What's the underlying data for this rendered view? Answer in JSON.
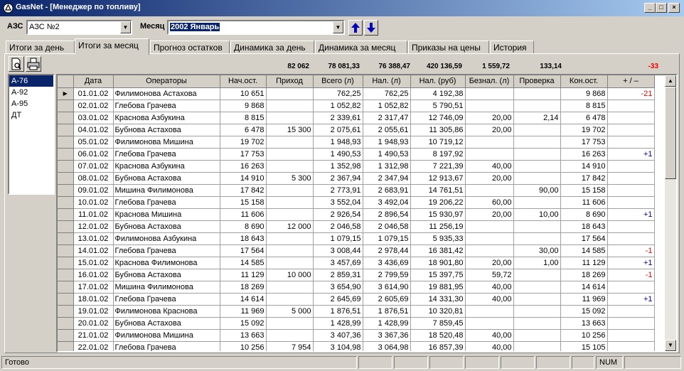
{
  "window": {
    "title": "GasNet - [Менеджер по топливу]",
    "icon": "gasnet-app-icon",
    "controls": [
      "_",
      "□",
      "×"
    ]
  },
  "filters": {
    "station_label": "АЗС",
    "station_value": "АЗС №2",
    "month_label": "Месяц",
    "month_value": "2002 Январь"
  },
  "tabs": [
    {
      "label": "Итоги за день"
    },
    {
      "label": "Итоги за месяц",
      "active": true
    },
    {
      "label": "Прогноз остатков"
    },
    {
      "label": "Динамика за день"
    },
    {
      "label": "Динамика за месяц"
    },
    {
      "label": "Приказы на цены"
    },
    {
      "label": "История"
    }
  ],
  "toolbar": [
    "preview-icon",
    "print-icon"
  ],
  "totals": {
    "incoming": "82 062",
    "total": "78 081,33",
    "cash_l": "76 388,47",
    "cash_rub": "420 136,59",
    "noncash": "1 559,72",
    "check": "133,14",
    "diff": "-33"
  },
  "fuel_types": [
    "А-76",
    "А-92",
    "А-95",
    "ДТ"
  ],
  "selected_fuel": 0,
  "columns": [
    "Дата",
    "Операторы",
    "Нач.ост.",
    "Приход",
    "Всего (л)",
    "Нал. (л)",
    "Нал. (руб)",
    "Безнал. (л)",
    "Проверка",
    "Кон.ост.",
    "+ / –"
  ],
  "rows": [
    [
      "01.01.02",
      "Филимонова Астахова",
      "10 651",
      "",
      "762,25",
      "762,25",
      "4 192,38",
      "",
      "",
      "9 868",
      "-21"
    ],
    [
      "02.01.02",
      "Глебова Грачева",
      "9 868",
      "",
      "1 052,82",
      "1 052,82",
      "5 790,51",
      "",
      "",
      "8 815",
      ""
    ],
    [
      "03.01.02",
      "Краснова Азбукина",
      "8 815",
      "",
      "2 339,61",
      "2 317,47",
      "12 746,09",
      "20,00",
      "2,14",
      "6 478",
      ""
    ],
    [
      "04.01.02",
      "Бубнова Астахова",
      "6 478",
      "15 300",
      "2 075,61",
      "2 055,61",
      "11 305,86",
      "20,00",
      "",
      "19 702",
      ""
    ],
    [
      "05.01.02",
      "Филимонова Мишина",
      "19 702",
      "",
      "1 948,93",
      "1 948,93",
      "10 719,12",
      "",
      "",
      "17 753",
      ""
    ],
    [
      "06.01.02",
      "Глебова Грачева",
      "17 753",
      "",
      "1 490,53",
      "1 490,53",
      "8 197,92",
      "",
      "",
      "16 263",
      "+1"
    ],
    [
      "07.01.02",
      "Краснова Азбукина",
      "16 263",
      "",
      "1 352,98",
      "1 312,98",
      "7 221,39",
      "40,00",
      "",
      "14 910",
      ""
    ],
    [
      "08.01.02",
      "Бубнова Астахова",
      "14 910",
      "5 300",
      "2 367,94",
      "2 347,94",
      "12 913,67",
      "20,00",
      "",
      "17 842",
      ""
    ],
    [
      "09.01.02",
      "Мишина Филимонова",
      "17 842",
      "",
      "2 773,91",
      "2 683,91",
      "14 761,51",
      "",
      "90,00",
      "15 158",
      ""
    ],
    [
      "10.01.02",
      "Глебова Грачева",
      "15 158",
      "",
      "3 552,04",
      "3 492,04",
      "19 206,22",
      "60,00",
      "",
      "11 606",
      ""
    ],
    [
      "11.01.02",
      "Краснова Мишина",
      "11 606",
      "",
      "2 926,54",
      "2 896,54",
      "15 930,97",
      "20,00",
      "10,00",
      "8 690",
      "+1"
    ],
    [
      "12.01.02",
      "Бубнова Астахова",
      "8 690",
      "12 000",
      "2 046,58",
      "2 046,58",
      "11 256,19",
      "",
      "",
      "18 643",
      ""
    ],
    [
      "13.01.02",
      "Филимонова Азбукина",
      "18 643",
      "",
      "1 079,15",
      "1 079,15",
      "5 935,33",
      "",
      "",
      "17 564",
      ""
    ],
    [
      "14.01.02",
      "Глебова Грачева",
      "17 564",
      "",
      "3 008,44",
      "2 978,44",
      "16 381,42",
      "",
      "30,00",
      "14 585",
      "-1"
    ],
    [
      "15.01.02",
      "Краснова Филимонова",
      "14 585",
      "",
      "3 457,69",
      "3 436,69",
      "18 901,80",
      "20,00",
      "1,00",
      "11 129",
      "+1"
    ],
    [
      "16.01.02",
      "Бубнова Астахова",
      "11 129",
      "10 000",
      "2 859,31",
      "2 799,59",
      "15 397,75",
      "59,72",
      "",
      "18 269",
      "-1"
    ],
    [
      "17.01.02",
      "Мишина Филимонова",
      "18 269",
      "",
      "3 654,90",
      "3 614,90",
      "19 881,95",
      "40,00",
      "",
      "14 614",
      ""
    ],
    [
      "18.01.02",
      "Глебова Грачева",
      "14 614",
      "",
      "2 645,69",
      "2 605,69",
      "14 331,30",
      "40,00",
      "",
      "11 969",
      "+1"
    ],
    [
      "19.01.02",
      "Филимонова Краснова",
      "11 969",
      "5 000",
      "1 876,51",
      "1 876,51",
      "10 320,81",
      "",
      "",
      "15 092",
      ""
    ],
    [
      "20.01.02",
      "Бубнова Астахова",
      "15 092",
      "",
      "1 428,99",
      "1 428,99",
      "7 859,45",
      "",
      "",
      "13 663",
      ""
    ],
    [
      "21.01.02",
      "Филимонова Мишина",
      "13 663",
      "",
      "3 407,36",
      "3 367,36",
      "18 520,48",
      "40,00",
      "",
      "10 256",
      ""
    ],
    [
      "22.01.02",
      "Глебова Грачева",
      "10 256",
      "7 954",
      "3 104,98",
      "3 064,98",
      "16 857,39",
      "40,00",
      "",
      "15 105",
      ""
    ]
  ],
  "current_row": 0,
  "status": {
    "text": "Готово",
    "num": "NUM"
  },
  "colors": {
    "negative": "#ff0000",
    "positive": "#0000c0",
    "selection": "#0a246a"
  }
}
